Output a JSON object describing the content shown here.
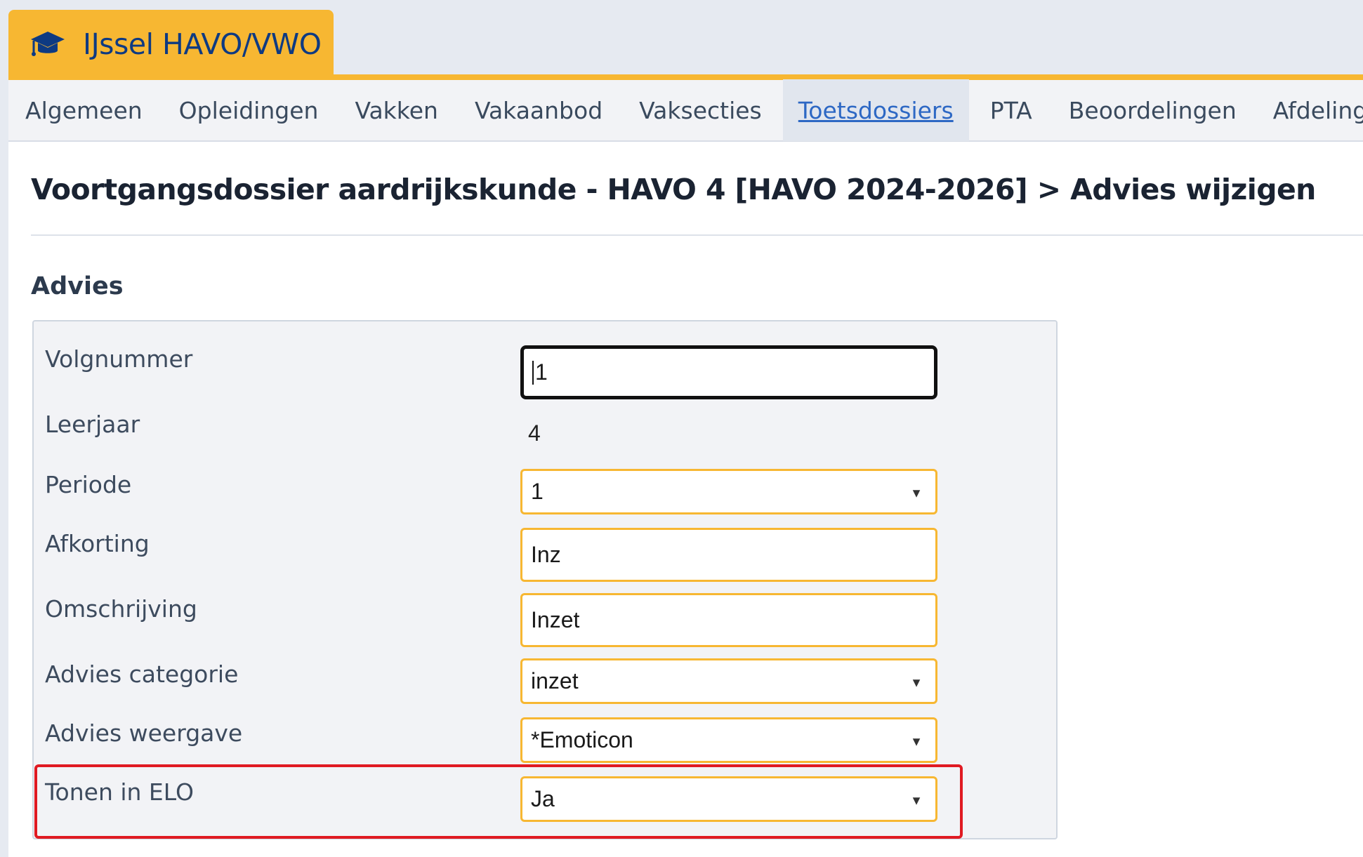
{
  "app": {
    "title": "IJssel HAVO/VWO",
    "brand_icon": "graduation-cap-icon",
    "accent_color": "#f7b732",
    "brand_text_color": "#0e3a82"
  },
  "nav": {
    "items": [
      {
        "label": "Algemeen"
      },
      {
        "label": "Opleidingen"
      },
      {
        "label": "Vakken"
      },
      {
        "label": "Vakaanbod"
      },
      {
        "label": "Vaksecties"
      },
      {
        "label": "Toetsdossiers",
        "active": true
      },
      {
        "label": "PTA"
      },
      {
        "label": "Beoordelingen"
      },
      {
        "label": "Afdelingen"
      }
    ]
  },
  "page": {
    "title": "Voortgangsdossier aardrijkskunde - HAVO 4 [HAVO 2024-2026] > Advies wijzigen",
    "section_title": "Advies"
  },
  "form": {
    "volgnummer": {
      "label": "Volgnummer",
      "value": "1"
    },
    "leerjaar": {
      "label": "Leerjaar",
      "value": "4"
    },
    "periode": {
      "label": "Periode",
      "value": "1"
    },
    "afkorting": {
      "label": "Afkorting",
      "value": "Inz"
    },
    "omschrijving": {
      "label": "Omschrijving",
      "value": "Inzet"
    },
    "advies_categorie": {
      "label": "Advies categorie",
      "value": "inzet"
    },
    "advies_weergave": {
      "label": "Advies weergave",
      "value": "*Emoticon"
    },
    "tonen_in_elo": {
      "label": "Tonen in ELO",
      "value": "Ja"
    }
  },
  "highlight_color": "#e01a22"
}
